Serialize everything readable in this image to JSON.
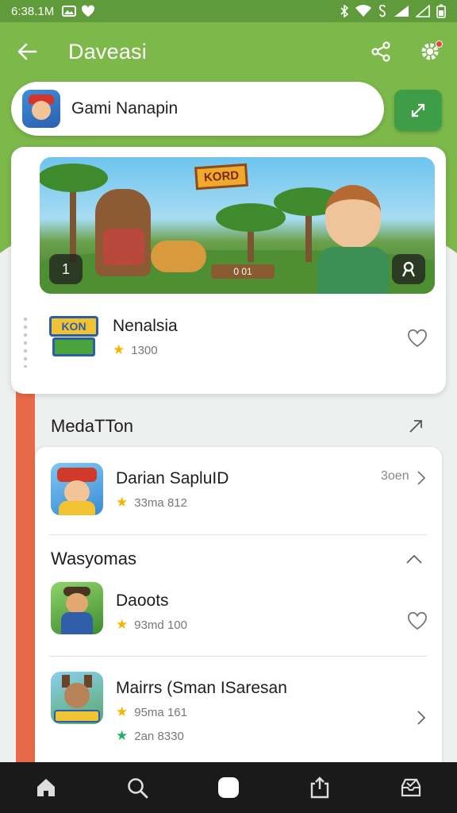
{
  "status_bar": {
    "time": "6:38.1M"
  },
  "app_bar": {
    "title": "Daveasi"
  },
  "search": {
    "value": "Gami Nanapin"
  },
  "featured": {
    "banner_sign": "KORD",
    "banner_counter": "0 01",
    "banner_left_badge": "1",
    "name": "Nenalsia",
    "rating": "1300"
  },
  "section_1": {
    "title": "MedaTTon"
  },
  "section_2": {
    "title": "Wasyomas"
  },
  "apps": [
    {
      "name": "Darian SapluID",
      "meta": "33ma 812",
      "action": "3oen",
      "icon": "cowboy-hat-character-icon"
    },
    {
      "name": "Daoots",
      "meta": "93md 100",
      "icon": "miner-character-icon"
    },
    {
      "name": "Mairrs (Sman ISaresan",
      "meta": "95ma 161",
      "meta2": "2an 8330",
      "icon": "wolf-character-icon"
    }
  ],
  "colors": {
    "primary_green": "#7cb84a",
    "accent_orange": "#e8694a",
    "star": "#f4b400",
    "action_green": "#3e9d47"
  }
}
